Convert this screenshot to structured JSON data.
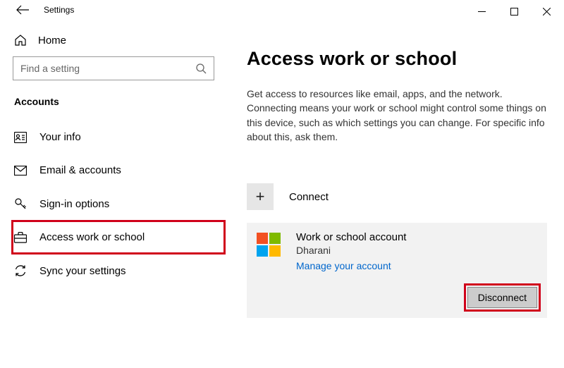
{
  "app": {
    "title": "Settings"
  },
  "sidebar": {
    "home": "Home",
    "search_placeholder": "Find a setting",
    "section": "Accounts",
    "items": [
      {
        "label": "Your info"
      },
      {
        "label": "Email & accounts"
      },
      {
        "label": "Sign-in options"
      },
      {
        "label": "Access work or school"
      },
      {
        "label": "Sync your settings"
      }
    ]
  },
  "main": {
    "heading": "Access work or school",
    "description": "Get access to resources like email, apps, and the network. Connecting means your work or school might control some things on this device, such as which settings you can change. For specific info about this, ask them.",
    "connect_label": "Connect",
    "account": {
      "title": "Work or school account",
      "subtitle": "Dharani",
      "manage_link": "Manage your account",
      "disconnect": "Disconnect"
    }
  }
}
